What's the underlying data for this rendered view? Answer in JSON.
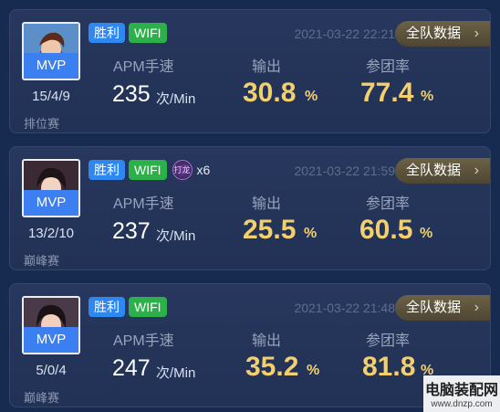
{
  "matches": [
    {
      "mvp": "MVP",
      "kda": "15/4/9",
      "mode": "排位赛",
      "result": "胜利",
      "network": "WIFI",
      "date": "2021-03-22 22:21",
      "team_button": "全队数据",
      "apm_label": "APM手速",
      "apm_value": "235",
      "apm_unit": "次/Min",
      "output_label": "输出",
      "output_value": "30.8",
      "team_label": "参团率",
      "team_value": "77.4",
      "percent": "%"
    },
    {
      "mvp": "MVP",
      "kda": "13/2/10",
      "mode": "巅峰赛",
      "result": "胜利",
      "network": "WIFI",
      "dragon_badge": "打龙",
      "dragon_count": "x6",
      "date": "2021-03-22 21:59",
      "team_button": "全队数据",
      "apm_label": "APM手速",
      "apm_value": "237",
      "apm_unit": "次/Min",
      "output_label": "输出",
      "output_value": "25.5",
      "team_label": "参团率",
      "team_value": "60.5",
      "percent": "%"
    },
    {
      "mvp": "MVP",
      "kda": "5/0/4",
      "mode": "巅峰赛",
      "result": "胜利",
      "network": "WIFI",
      "date": "2021-03-22 21:48",
      "team_button": "全队数据",
      "apm_label": "APM手速",
      "apm_value": "247",
      "apm_unit": "次/Min",
      "output_label": "输出",
      "output_value": "35.2",
      "team_label": "参团率",
      "team_value": "81.8",
      "percent": "%"
    }
  ],
  "watermark": {
    "title": "电脑装配网",
    "url": "www.dnzp.com"
  },
  "colors": {
    "background": "#172a4f",
    "accent_gold": "#f3cf6e",
    "win": "#2f87f0",
    "wifi": "#2cb14a",
    "mvp": "#3b7ff0"
  },
  "icons": {
    "team_button_chevron": "chevron-right-icon",
    "hero_avatar": "hero-portrait"
  }
}
